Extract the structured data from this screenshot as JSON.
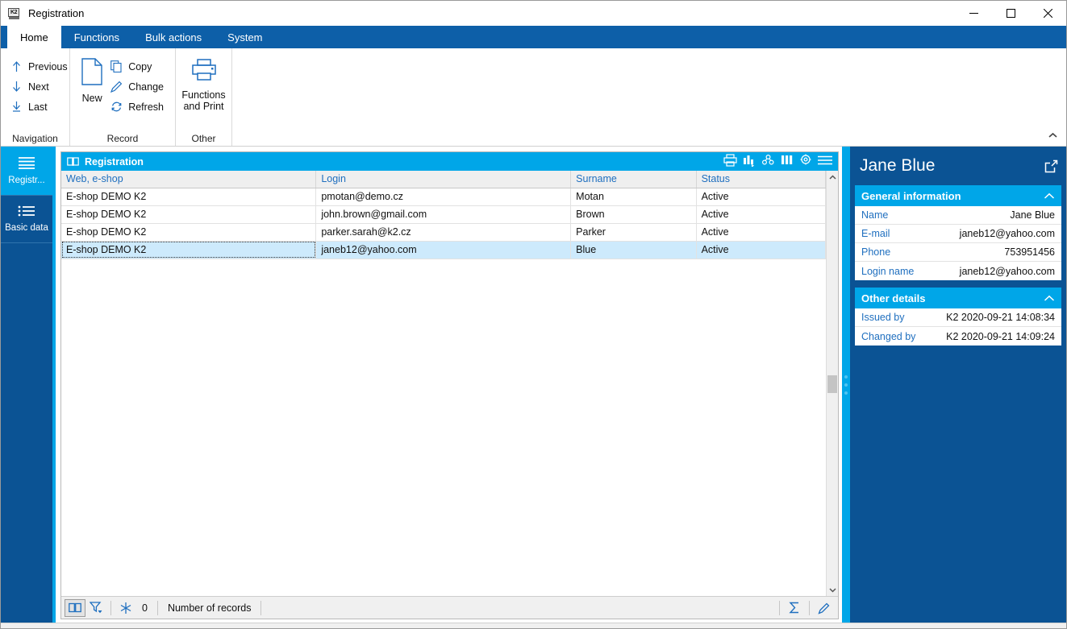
{
  "window": {
    "title": "Registration",
    "app_icon": "k2-app-icon",
    "controls": {
      "minimize": "minimize-icon",
      "maximize": "maximize-icon",
      "close": "close-icon"
    }
  },
  "ribbon": {
    "tabs": [
      {
        "label": "Home",
        "active": true
      },
      {
        "label": "Functions",
        "active": false
      },
      {
        "label": "Bulk actions",
        "active": false
      },
      {
        "label": "System",
        "active": false
      }
    ],
    "groups": [
      {
        "title": "Navigation",
        "small_buttons": [
          {
            "label": "Previous",
            "icon": "arrow-up-icon"
          },
          {
            "label": "Next",
            "icon": "arrow-down-icon"
          },
          {
            "label": "Last",
            "icon": "arrow-down-to-line-icon"
          }
        ]
      },
      {
        "title": "Record",
        "big_button": {
          "label": "New",
          "icon": "new-document-icon"
        },
        "small_buttons": [
          {
            "label": "Copy",
            "icon": "copy-icon"
          },
          {
            "label": "Change",
            "icon": "pencil-icon"
          },
          {
            "label": "Refresh",
            "icon": "refresh-icon"
          }
        ]
      },
      {
        "title": "Other",
        "big_button": {
          "label": "Functions and Print",
          "icon": "printer-icon"
        }
      }
    ],
    "collapse_icon": "chevron-up-icon"
  },
  "sidebar": {
    "items": [
      {
        "label": "Registr...",
        "icon": "list-lines-icon",
        "active": true
      },
      {
        "label": "Basic data",
        "icon": "list-bullet-icon",
        "active": false
      }
    ]
  },
  "grid": {
    "caption": "Registration",
    "caption_icon": "book-icon",
    "toolbar_icons": [
      "printer-icon",
      "bar-chart-icon",
      "pivot-icon",
      "columns-icon",
      "settings-gear-icon",
      "menu-hamburger-icon"
    ],
    "columns": [
      "Web, e-shop",
      "Login",
      "Surname",
      "Status"
    ],
    "rows": [
      {
        "web_eshop": "E-shop DEMO K2",
        "login": "pmotan@demo.cz",
        "surname": "Motan",
        "status": "Active",
        "selected": false
      },
      {
        "web_eshop": "E-shop DEMO K2",
        "login": "john.brown@gmail.com",
        "surname": "Brown",
        "status": "Active",
        "selected": false
      },
      {
        "web_eshop": "E-shop DEMO K2",
        "login": "parker.sarah@k2.cz",
        "surname": "Parker",
        "status": "Active",
        "selected": false
      },
      {
        "web_eshop": "E-shop DEMO K2",
        "login": "janeb12@yahoo.com",
        "surname": "Blue",
        "status": "Active",
        "selected": true
      }
    ],
    "scrollbar": {
      "up_icon": "chevron-up-icon",
      "down_icon": "chevron-down-icon"
    }
  },
  "statusbar": {
    "book_icon": "book-icon",
    "filter_icon": "filter-icon",
    "snowflake_icon": "snowflake-icon",
    "count": "0",
    "records_label": "Number of records",
    "sum_icon": "sigma-icon",
    "edit_icon": "pencil-icon"
  },
  "detail": {
    "title": "Jane Blue",
    "expand_icon": "open-external-icon",
    "sections": [
      {
        "heading": "General information",
        "chevron": "chevron-up-icon",
        "rows": [
          {
            "label": "Name",
            "value": "Jane Blue"
          },
          {
            "label": "E-mail",
            "value": "janeb12@yahoo.com"
          },
          {
            "label": "Phone",
            "value": "753951456"
          },
          {
            "label": "Login name",
            "value": "janeb12@yahoo.com"
          }
        ]
      },
      {
        "heading": "Other details",
        "chevron": "chevron-up-icon",
        "rows": [
          {
            "label": "Issued by",
            "value": "K2 2020-09-21 14:08:34"
          },
          {
            "label": "Changed by",
            "value": "K2 2020-09-21 14:09:24"
          }
        ]
      }
    ]
  },
  "colors": {
    "ribbon_blue": "#0b5394",
    "accent_cyan": "#00a6e8",
    "header_text_blue": "#1f6fbf",
    "selection": "#cdeafc"
  }
}
